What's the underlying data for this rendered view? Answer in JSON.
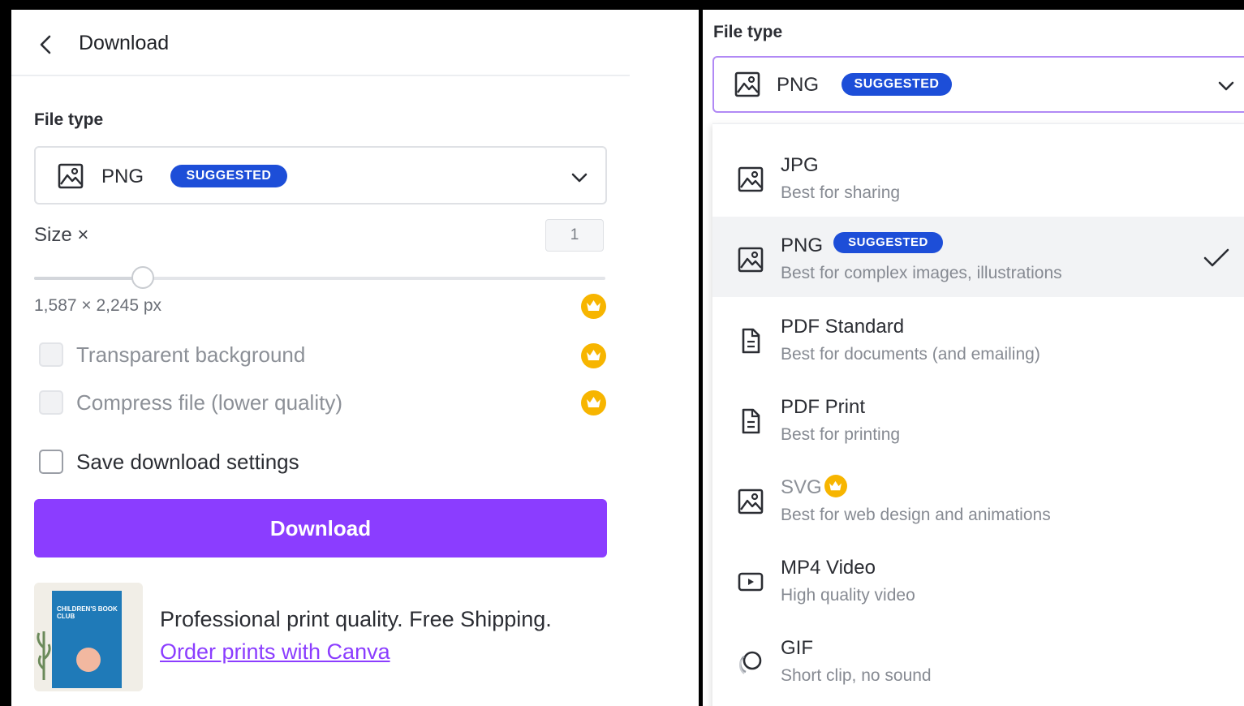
{
  "left": {
    "header": {
      "title": "Download"
    },
    "file_type_label": "File type",
    "file_type": {
      "value": "PNG",
      "badge": "SUGGESTED"
    },
    "size": {
      "label": "Size ×",
      "value": "1",
      "level_fraction": 0.19
    },
    "dimensions": "1,587 × 2,245 px",
    "options": [
      {
        "label": "Transparent background",
        "checked": false,
        "disabled": true,
        "premium": true
      },
      {
        "label": "Compress file (lower quality)",
        "checked": false,
        "disabled": true,
        "premium": true
      },
      {
        "label": "Save download settings",
        "checked": false,
        "disabled": false,
        "premium": false
      }
    ],
    "download_button": "Download",
    "promo": {
      "text": "Professional print quality. Free Shipping.",
      "link": "Order prints with Canva",
      "thumbnail_title": "CHILDREN'S BOOK CLUB"
    }
  },
  "right": {
    "file_type_label": "File type",
    "file_type": {
      "value": "PNG",
      "badge": "SUGGESTED"
    },
    "dropdown": [
      {
        "title": "JPG",
        "description": "Best for sharing",
        "icon": "image-icon"
      },
      {
        "title": "PNG",
        "badge": "SUGGESTED",
        "description": "Best for complex images, illustrations",
        "icon": "image-icon",
        "selected": true
      },
      {
        "title": "PDF Standard",
        "description": "Best for documents (and emailing)",
        "icon": "document-icon"
      },
      {
        "title": "PDF Print",
        "description": "Best for printing",
        "icon": "document-icon"
      },
      {
        "title": "SVG",
        "description": "Best for web design and animations",
        "icon": "image-icon",
        "premium": true
      },
      {
        "title": "MP4 Video",
        "description": "High quality video",
        "icon": "video-icon"
      },
      {
        "title": "GIF",
        "description": "Short clip, no sound",
        "icon": "gif-icon"
      }
    ]
  },
  "colors": {
    "accent": "#8b3dff",
    "badge": "#1d4ed8",
    "crown": "#f7b500"
  }
}
